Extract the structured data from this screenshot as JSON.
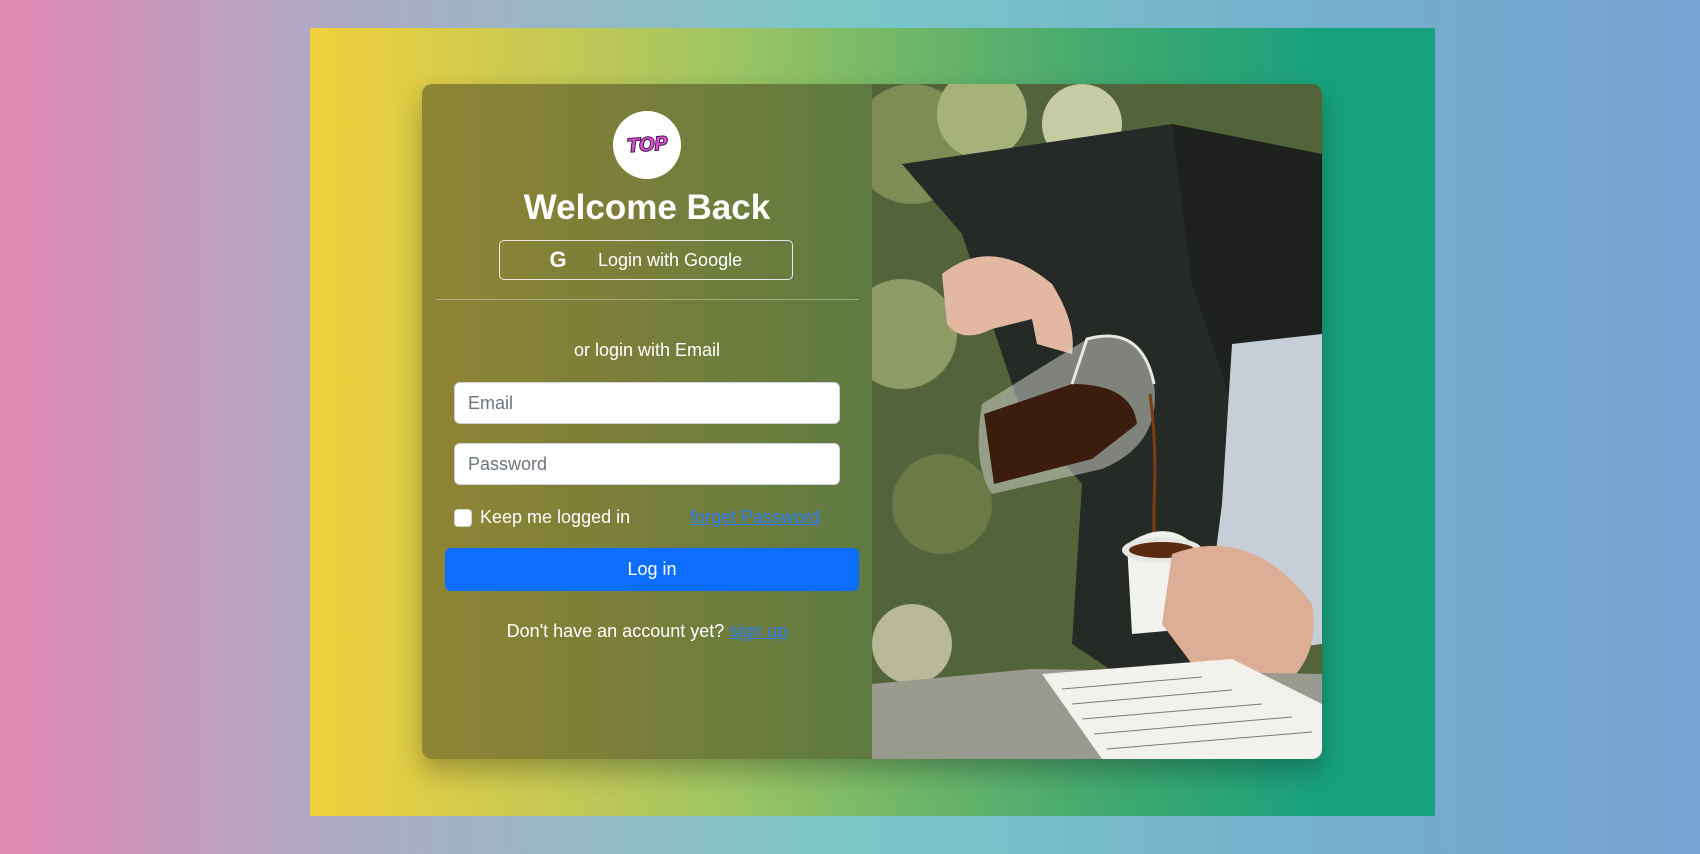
{
  "logo": {
    "text": "TOP",
    "accent": "#e24fd6"
  },
  "heading": "Welcome Back",
  "google_button": {
    "label": "Login with Google",
    "icon": "google-g-icon"
  },
  "divider_text": "or login with Email",
  "email_field": {
    "placeholder": "Email",
    "value": ""
  },
  "password_field": {
    "placeholder": "Password",
    "value": ""
  },
  "remember_me": {
    "label": "Keep me logged in",
    "checked": false
  },
  "forgot_link": "forget Password",
  "login_button": {
    "label": "Log in",
    "color": "#0d6efd"
  },
  "signup": {
    "prompt": "Don't have an account yet?",
    "link": "sign up"
  },
  "photo": {
    "description_icon": "coffee-pour-photo"
  }
}
